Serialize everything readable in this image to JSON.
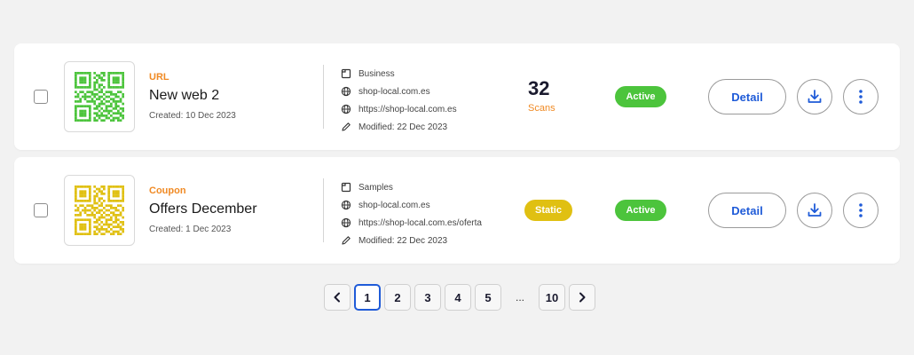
{
  "colors": {
    "accent_blue": "#1f5bd8",
    "type_label_orange": "#f08a24",
    "qr_green": "#4cc43c",
    "qr_yellow": "#e0c012",
    "active_green": "#4cc43c",
    "static_yellow": "#e0c012"
  },
  "items": [
    {
      "type": "URL",
      "name": "New web 2",
      "created": "Created: 10 Dec 2023",
      "qr_icon": "qr-code-icon",
      "qr_color": "#4cc43c",
      "meta": {
        "folder": "Business",
        "domain": "shop-local.com.es",
        "url": "https://shop-local.com.es",
        "modified": "Modified: 22 Dec 2023"
      },
      "scans": {
        "count": "32",
        "label": "Scans"
      },
      "status": "Active",
      "detail_label": "Detail"
    },
    {
      "type": "Coupon",
      "name": "Offers December",
      "created": "Created: 1 Dec 2023",
      "qr_icon": "qr-code-icon",
      "qr_color": "#e0c012",
      "meta": {
        "folder": "Samples",
        "domain": "shop-local.com.es",
        "url": "https://shop-local.com.es/oferta",
        "modified": "Modified: 22 Dec 2023"
      },
      "badge_static": "Static",
      "status": "Active",
      "detail_label": "Detail"
    }
  ],
  "pagination": {
    "current_page": 1,
    "pages": [
      "1",
      "2",
      "3",
      "4",
      "5"
    ],
    "ellipsis": "...",
    "last_page": "10",
    "prev_icon": "chevron-left-icon",
    "next_icon": "chevron-right-icon"
  }
}
